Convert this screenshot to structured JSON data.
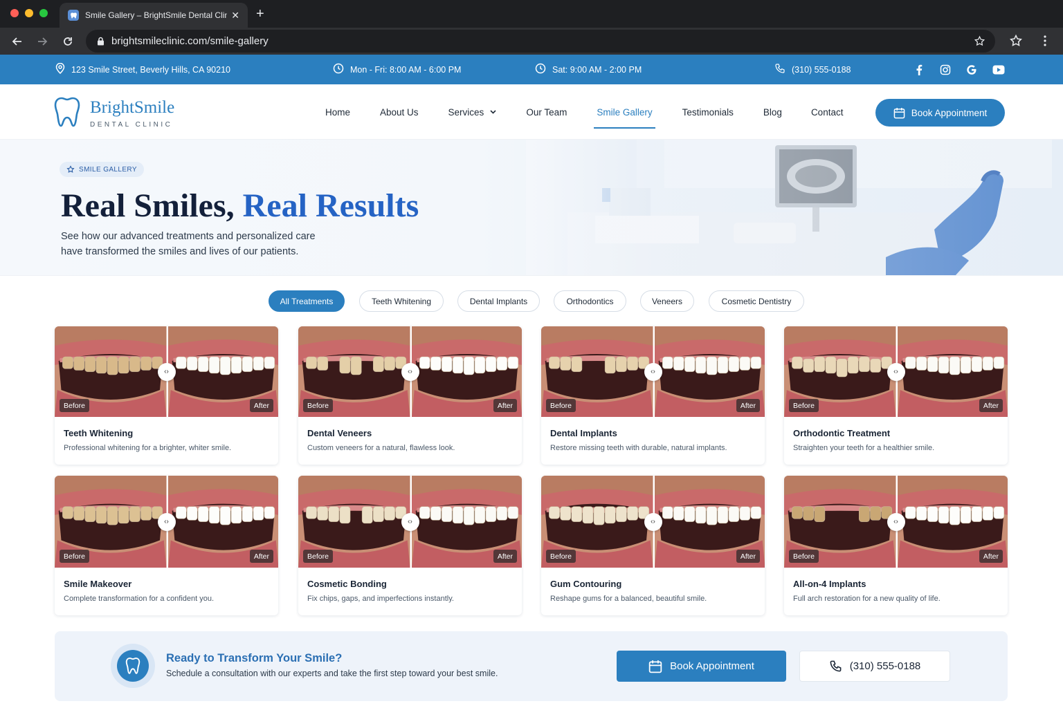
{
  "browser": {
    "tab_title": "Smile Gallery – BrightSmile Dental Clinic",
    "url": "brightsmileclinic.com/smile-gallery",
    "icons": [
      "back-icon",
      "forward-icon",
      "reload-icon",
      "lock-icon",
      "bookmark-star-icon",
      "extensions-icon",
      "menu-icon"
    ]
  },
  "infobar": {
    "address": "123 Smile Street, Beverly Hills, CA 90210",
    "hours_weekday": "Mon - Fri: 8:00 AM - 6:00 PM",
    "hours_saturday": "Sat: 9:00 AM - 2:00 PM",
    "phone": "(310) 555-0188",
    "socials": [
      "facebook-icon",
      "instagram-icon",
      "google-icon",
      "youtube-icon"
    ]
  },
  "nav": {
    "brand": "BrightSmile",
    "brand_sub": "DENTAL CLINIC",
    "links": [
      "Home",
      "About Us",
      "Services",
      "Our Team",
      "Smile Gallery",
      "Testimonials",
      "Blog",
      "Contact"
    ],
    "active": "Smile Gallery",
    "book_label": "Book Appointment"
  },
  "hero": {
    "badge": "SMILE GALLERY",
    "title_main": "Real Smiles, ",
    "title_accent": "Real Results",
    "desc_line1": "See how our advanced treatments and personalized care",
    "desc_line2": "have transformed the smiles and lives of our patients."
  },
  "filters": {
    "items": [
      "All Treatments",
      "Teeth Whitening",
      "Dental Implants",
      "Orthodontics",
      "Veneers",
      "Cosmetic Dentistry"
    ],
    "active": "All Treatments"
  },
  "gallery": {
    "before_label": "Before",
    "after_label": "After",
    "cards": [
      {
        "title": "Teeth Whitening",
        "desc": "Professional whitening for a brighter, whiter smile."
      },
      {
        "title": "Dental Veneers",
        "desc": "Custom veneers for a natural, flawless look."
      },
      {
        "title": "Dental Implants",
        "desc": "Restore missing teeth with durable, natural implants."
      },
      {
        "title": "Orthodontic Treatment",
        "desc": "Straighten your teeth for a healthier smile."
      },
      {
        "title": "Smile Makeover",
        "desc": "Complete transformation for a confident you."
      },
      {
        "title": "Cosmetic Bonding",
        "desc": "Fix chips, gaps, and imperfections instantly."
      },
      {
        "title": "Gum Contouring",
        "desc": "Reshape gums for a balanced, beautiful smile."
      },
      {
        "title": "All-on-4 Implants",
        "desc": "Full arch restoration for a new quality of life."
      }
    ]
  },
  "cta": {
    "title": "Ready to Transform Your Smile?",
    "desc": "Schedule a consultation with our experts and take the first step toward your best smile.",
    "book_label": "Book Appointment",
    "phone": "(310) 555-0188"
  },
  "colors": {
    "brand": "#2b7fbf",
    "accent": "#2563c4",
    "dark": "#13203a"
  }
}
